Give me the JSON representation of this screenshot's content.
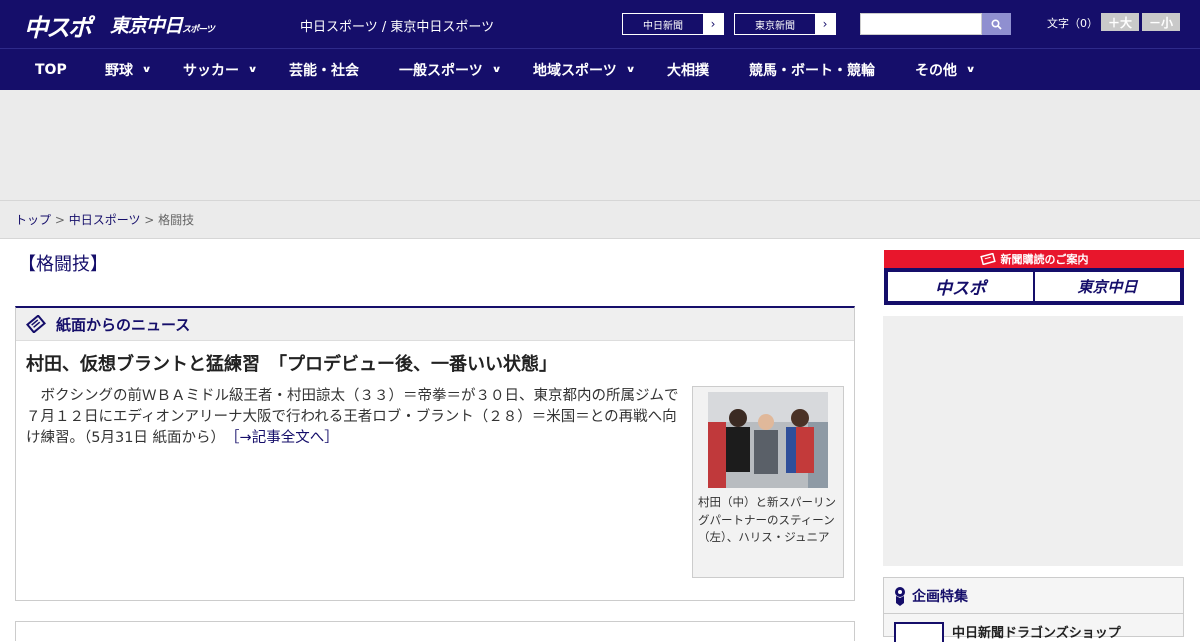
{
  "header": {
    "logo_chuspo": "中スポ",
    "logo_tokyo": "東京中日",
    "logo_tokyo_small": "スポーツ",
    "site_title": "中日スポーツ / 東京中日スポーツ",
    "ext_links": [
      "中日新聞",
      "東京新聞"
    ],
    "search_placeholder": "",
    "fontsize_label": "文字（0）",
    "fontsize_up": "＋大",
    "fontsize_down": "－小"
  },
  "nav": {
    "items": [
      {
        "label": "TOP",
        "chevron": ""
      },
      {
        "label": "野球",
        "chevron": "∨"
      },
      {
        "label": "サッカー",
        "chevron": "∨"
      },
      {
        "label": "芸能・社会",
        "chevron": ""
      },
      {
        "label": "一般スポーツ",
        "chevron": "∨"
      },
      {
        "label": "地域スポーツ",
        "chevron": "∨"
      },
      {
        "label": "大相撲",
        "chevron": ""
      },
      {
        "label": "競馬・ボート・競輪",
        "chevron": ""
      },
      {
        "label": "その他",
        "chevron": "∨"
      }
    ]
  },
  "breadcrumb": {
    "home": "トップ",
    "section": "中日スポーツ",
    "current": "格闘技",
    "sep": " > "
  },
  "page": {
    "heading": "【格闘技】"
  },
  "news": {
    "section_title": "紙面からのニュース",
    "article_title": "村田、仮想ブラントと猛練習　「プロデビュー後、一番いい状態」",
    "article_body": "　ボクシングの前ＷＢＡミドル級王者・村田諒太（３３）＝帝拳＝が３０日、東京都内の所属ジムで７月１２日にエディオンアリーナ大阪で行われる王者ロブ・ブラント（２８）＝米国＝との再戦へ向け練習。（5月31日 紙面から）",
    "read_more": "［→記事全文へ］",
    "photo_caption": "村田（中）と新スパーリングパートナーのスティーン（左）、ハリス・ジュニア"
  },
  "sidebar": {
    "banner_title": "新聞購読のご案内",
    "banner_logo_left": "中スポ",
    "banner_logo_right": "東京中日",
    "feature_title": "企画特集",
    "feature_item": "中日新聞ドラゴンズショップ"
  },
  "colors": {
    "brand_navy": "#150e6a",
    "banner_red": "#e8162c",
    "gray_band": "#ebebeb"
  }
}
